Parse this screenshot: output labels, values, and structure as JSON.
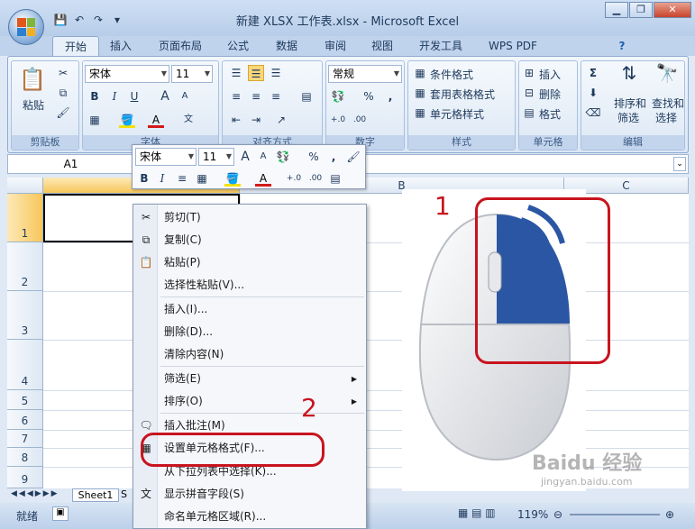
{
  "window": {
    "title": "新建 XLSX 工作表.xlsx - Microsoft Excel",
    "controls": {
      "minimize": "▁",
      "restore": "❐",
      "close": "✕"
    },
    "help": "?"
  },
  "tabs": [
    "开始",
    "插入",
    "页面布局",
    "公式",
    "数据",
    "审阅",
    "视图",
    "开发工具",
    "WPS PDF"
  ],
  "ribbon": {
    "clipboard": {
      "label": "剪贴板",
      "paste": "粘贴"
    },
    "font": {
      "label": "字体",
      "name": "宋体",
      "size": "11",
      "bold": "B",
      "italic": "I",
      "underline": "U",
      "grow": "A",
      "shrink": "A",
      "wen": "文"
    },
    "alignment": {
      "label": "对齐方式"
    },
    "number": {
      "label": "数字",
      "format": "常规",
      "percent": "%",
      "comma": ","
    },
    "styles": {
      "label": "样式",
      "conditional": "条件格式",
      "table": "套用表格格式",
      "cell": "单元格样式"
    },
    "cells": {
      "label": "单元格",
      "insert": "插入",
      "delete": "删除",
      "format": "格式"
    },
    "editing": {
      "label": "编辑",
      "sum": "Σ",
      "sort": "排序和",
      "sort2": "筛选",
      "find": "查找和",
      "find2": "选择"
    }
  },
  "formula_bar": {
    "name_box": "A1"
  },
  "grid": {
    "columns": [
      "A",
      "B",
      "C"
    ],
    "rows": [
      "1",
      "2",
      "3",
      "4",
      "5",
      "6",
      "7",
      "8",
      "9"
    ]
  },
  "sheet_tabs": [
    "Sheet1",
    "S"
  ],
  "status": {
    "ready": "就绪",
    "zoom": "119%"
  },
  "mini_toolbar": {
    "font": "宋体",
    "size": "11",
    "bold": "B",
    "italic": "I",
    "percent": "%",
    "comma": ","
  },
  "context_menu": [
    {
      "label": "剪切(T)",
      "icon": "scissors-icon",
      "glyph": "✂"
    },
    {
      "label": "复制(C)",
      "icon": "copy-icon",
      "glyph": "⧉"
    },
    {
      "label": "粘贴(P)",
      "icon": "paste-icon",
      "glyph": "📋"
    },
    {
      "label": "选择性粘贴(V)...",
      "icon": "",
      "glyph": ""
    },
    {
      "label": "插入(I)...",
      "icon": "",
      "glyph": ""
    },
    {
      "label": "删除(D)...",
      "icon": "",
      "glyph": ""
    },
    {
      "label": "清除内容(N)",
      "icon": "",
      "glyph": ""
    },
    {
      "label": "筛选(E)",
      "icon": "",
      "glyph": "",
      "submenu": true
    },
    {
      "label": "排序(O)",
      "icon": "",
      "glyph": "",
      "submenu": true
    },
    {
      "label": "插入批注(M)",
      "icon": "comment-icon",
      "glyph": "🗨"
    },
    {
      "label": "设置单元格格式(F)...",
      "icon": "format-cells-icon",
      "glyph": "▦"
    },
    {
      "label": "从下拉列表中选择(K)...",
      "icon": "",
      "glyph": ""
    },
    {
      "label": "显示拼音字段(S)",
      "icon": "phonetic-icon",
      "glyph": "文"
    },
    {
      "label": "命名单元格区域(R)...",
      "icon": "",
      "glyph": ""
    }
  ],
  "annotations": {
    "one": "1",
    "two": "2",
    "color": "#c8141e"
  },
  "watermark": {
    "brand": "Baidu 经验",
    "url": "jingyan.baidu.com"
  }
}
